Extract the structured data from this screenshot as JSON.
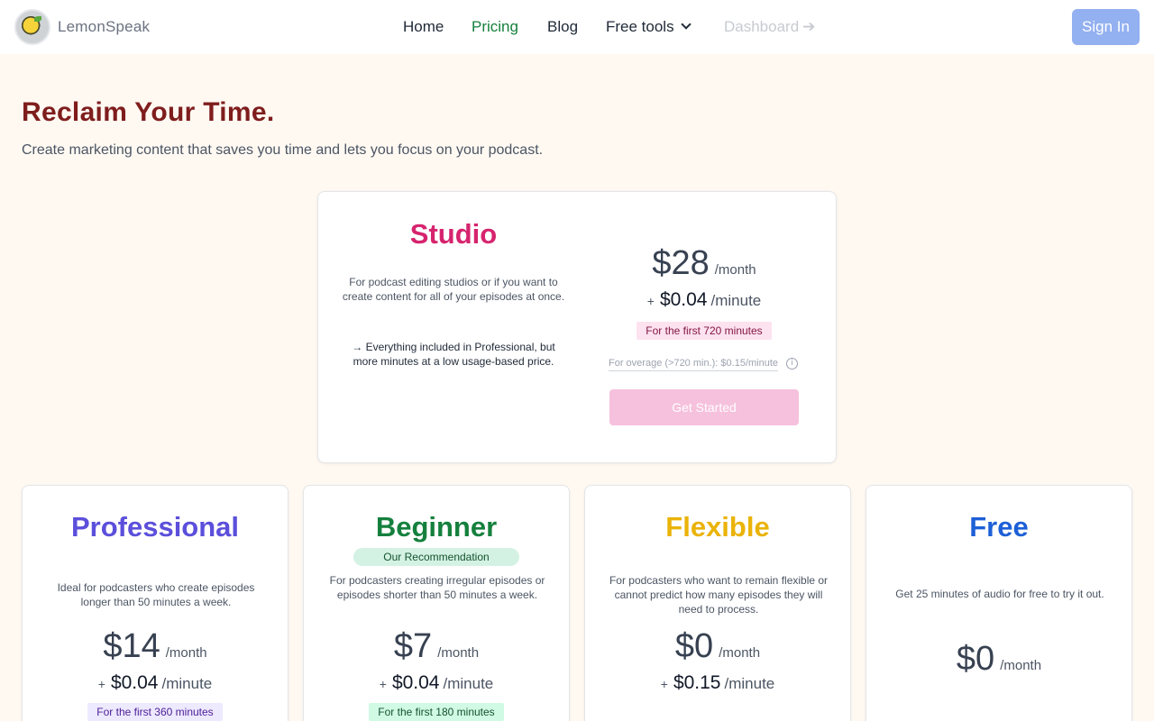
{
  "header": {
    "brand": "LemonSpeak",
    "nav": [
      {
        "label": "Home"
      },
      {
        "label": "Pricing"
      },
      {
        "label": "Blog"
      },
      {
        "label": "Free tools"
      },
      {
        "label": "Dashboard"
      }
    ],
    "signin_label": "Sign In"
  },
  "hero": {
    "title": "Reclaim Your Time.",
    "subtitle": "Create marketing content that saves you time and lets you focus on your podcast."
  },
  "studio": {
    "name": "Studio",
    "description": "For podcast editing studios or if you want to create content for all of your episodes at once.",
    "features": "→ Everything included in Professional, but more minutes at a low usage-based price.",
    "price": "$28",
    "price_unit": "/month",
    "plus": "+",
    "minute_price": "$0.04",
    "minute_unit": "/minute",
    "badge": "For the first 720 minutes",
    "overage": "For overage (>720 min.): $0.15/minute",
    "cta": "Get Started"
  },
  "plans": [
    {
      "name": "Professional",
      "description": "Ideal for podcasters who create episodes longer than 50 minutes a week.",
      "price": "$14",
      "price_unit": "/month",
      "plus": "+",
      "minute_price": "$0.04",
      "minute_unit": "/minute",
      "badge": "For the first 360 minutes"
    },
    {
      "name": "Beginner",
      "recommendation": "Our Recommendation",
      "description": "For podcasters creating irregular episodes or episodes shorter than 50 minutes a week.",
      "price": "$7",
      "price_unit": "/month",
      "plus": "+",
      "minute_price": "$0.04",
      "minute_unit": "/minute",
      "badge": "For the first 180 minutes"
    },
    {
      "name": "Flexible",
      "description": "For podcasters who want to remain flexible or cannot predict how many episodes they will need to process.",
      "price": "$0",
      "price_unit": "/month",
      "plus": "+",
      "minute_price": "$0.15",
      "minute_unit": "/minute"
    },
    {
      "name": "Free",
      "description": "Get 25 minutes of audio for free to try it out.",
      "price": "$0",
      "price_unit": "/month"
    }
  ],
  "colors": {
    "studio": "#d6246e",
    "professional": "#5b4fdb",
    "beginner": "#15803d",
    "flexible": "#eab308",
    "free": "#1d5fd6",
    "badge_studio_bg": "#fde2ef",
    "badge_pro_bg": "#ede9fe",
    "badge_beginner_bg": "#d1fae5"
  },
  "icons": {
    "dropdown": "chevron-down-icon",
    "dashboard_arrow": "arrow-right-icon",
    "info": "info-icon",
    "logo": "lemon-logo"
  }
}
